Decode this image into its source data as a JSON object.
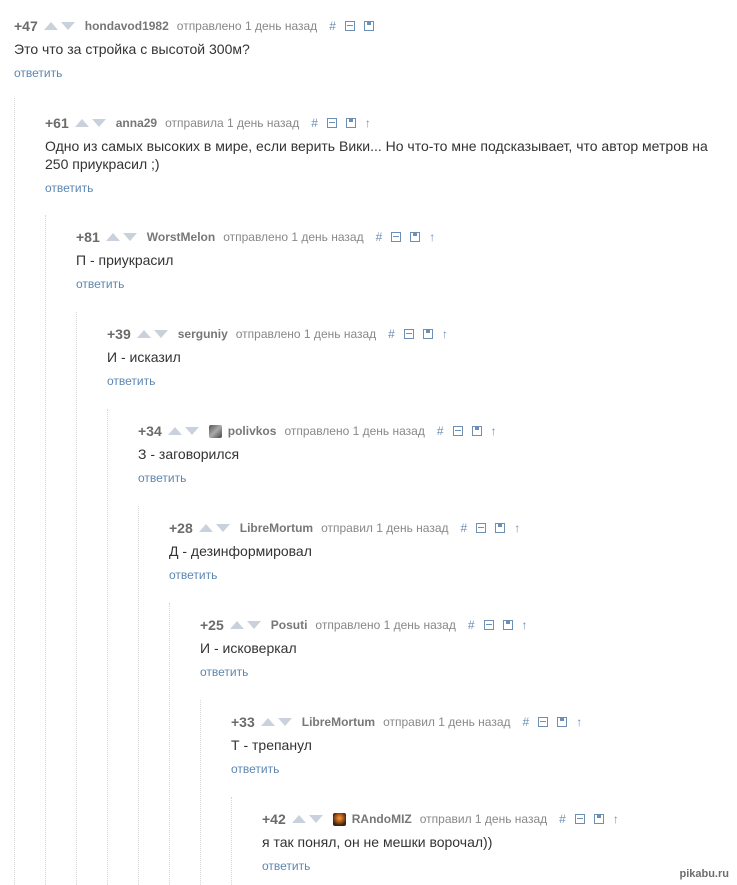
{
  "ui": {
    "hash": "#",
    "up_arrow": "↑"
  },
  "comments": [
    {
      "rating": "+47",
      "user": "hondavod1982",
      "meta": "отправлено 1 день назад",
      "text": "Это что за стройка с высотой 300м?",
      "reply": "ответить"
    },
    {
      "rating": "+61",
      "user": "anna29",
      "meta": "отправила 1 день назад",
      "text": "Одно из самых высоких в мире, если верить Вики... Но что-то мне подсказывает, что автор метров на 250 приукрасил ;)",
      "reply": "ответить"
    },
    {
      "rating": "+81",
      "user": "WorstMelon",
      "meta": "отправлено 1 день назад",
      "text": "П - приукрасил",
      "reply": "ответить"
    },
    {
      "rating": "+39",
      "user": "serguniy",
      "meta": "отправлено 1 день назад",
      "text": "И - исказил",
      "reply": "ответить"
    },
    {
      "rating": "+34",
      "user": "polivkos",
      "meta": "отправлено 1 день назад",
      "text": "З - заговорился",
      "reply": "ответить"
    },
    {
      "rating": "+28",
      "user": "LibreMortum",
      "meta": "отправил 1 день назад",
      "text": "Д - дезинформировал",
      "reply": "ответить"
    },
    {
      "rating": "+25",
      "user": "Posuti",
      "meta": "отправлено 1 день назад",
      "text": "И - исковеркал",
      "reply": "ответить"
    },
    {
      "rating": "+33",
      "user": "LibreMortum",
      "meta": "отправил 1 день назад",
      "text": "Т - трепанул",
      "reply": "ответить"
    },
    {
      "rating": "+42",
      "user": "RAndoMIZ",
      "meta": "отправил 1 день назад",
      "text": "я так понял, он не мешки ворочал))",
      "reply": "ответить"
    }
  ],
  "watermark": "pikabu.ru"
}
